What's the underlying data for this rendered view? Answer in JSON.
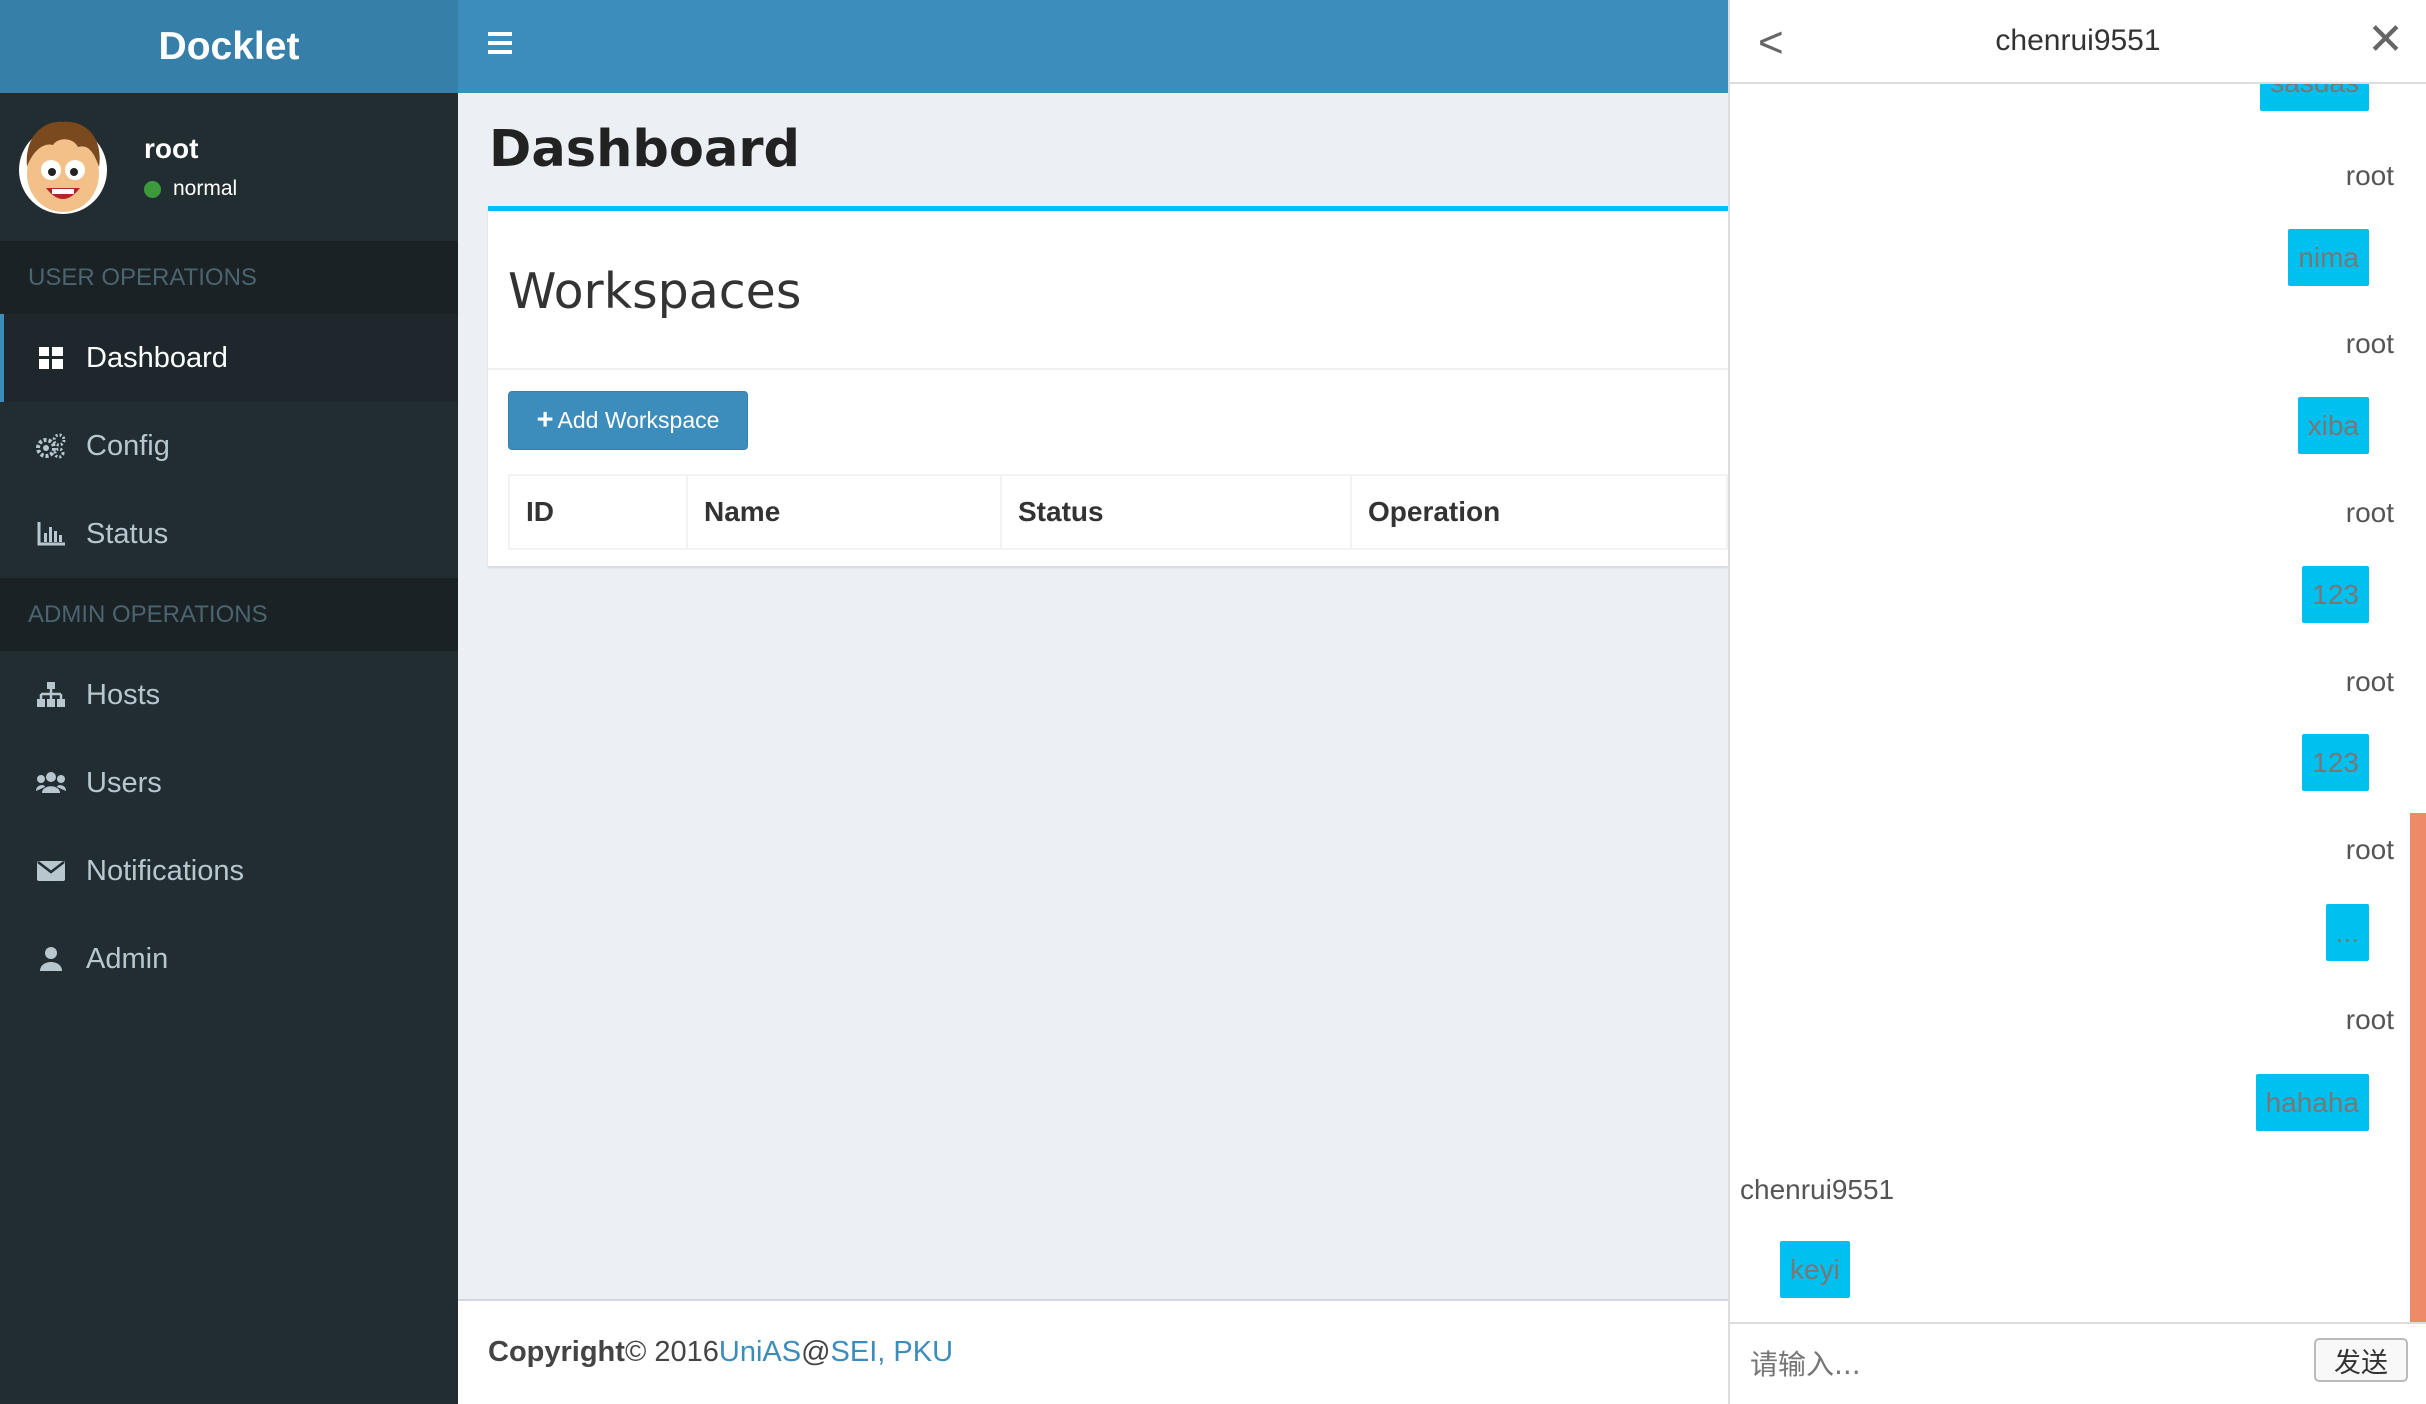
{
  "app": {
    "brand": "Docklet"
  },
  "user": {
    "name": "root",
    "status": "normal"
  },
  "sidebar": {
    "user_section": "USER OPERATIONS",
    "user_items": [
      {
        "label": "Dashboard",
        "icon": "dashboard-icon"
      },
      {
        "label": "Config",
        "icon": "gears-icon"
      },
      {
        "label": "Status",
        "icon": "bar-chart-icon"
      }
    ],
    "admin_section": "ADMIN OPERATIONS",
    "admin_items": [
      {
        "label": "Hosts",
        "icon": "sitemap-icon"
      },
      {
        "label": "Users",
        "icon": "users-icon"
      },
      {
        "label": "Notifications",
        "icon": "envelope-icon"
      },
      {
        "label": "Admin",
        "icon": "user-icon"
      }
    ]
  },
  "main": {
    "page_title": "Dashboard",
    "box_title": "Workspaces",
    "add_button": "Add Workspace",
    "table_headers": [
      "ID",
      "Name",
      "Status",
      "Operation"
    ]
  },
  "footer": {
    "copyright": "Copyright",
    "year_text": "© 2016 ",
    "org": "UniAS",
    "at": "@ ",
    "dept": "SEI, PKU"
  },
  "chat": {
    "title": "chenrui9551",
    "messages": [
      {
        "sender": "",
        "text": "sasdas"
      },
      {
        "sender": "root",
        "text": "nima"
      },
      {
        "sender": "root",
        "text": "xiba"
      },
      {
        "sender": "root",
        "text": "123"
      },
      {
        "sender": "root",
        "text": "123"
      },
      {
        "sender": "root",
        "text": "..."
      },
      {
        "sender": "root",
        "text": "hahaha"
      },
      {
        "sender": "chenrui9551",
        "text": "keyi"
      }
    ],
    "input_placeholder": "请输入...",
    "send_label": "发送"
  },
  "colors": {
    "sidebar_bg": "#222d32",
    "header_bg": "#3c8dbc",
    "accent": "#00c0ef",
    "scrollbar": "#ee8a68"
  }
}
